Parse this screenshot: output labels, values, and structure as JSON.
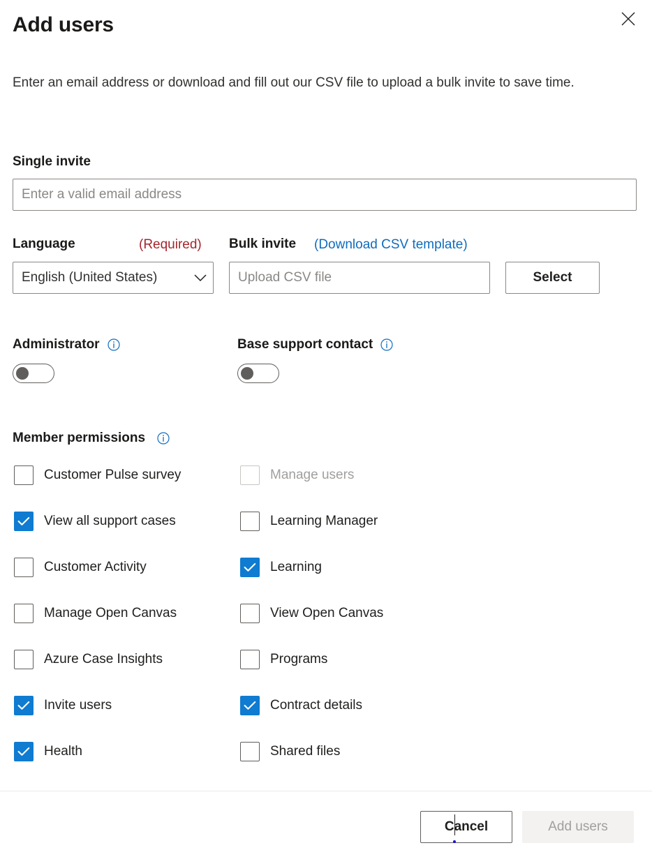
{
  "dialog": {
    "title": "Add users",
    "close_icon": "close-icon",
    "description": "Enter an email address or download and fill out our CSV file to upload a bulk invite to save time."
  },
  "single_invite": {
    "label": "Single invite",
    "email_placeholder": "Enter a valid email address",
    "email_value": ""
  },
  "language": {
    "label": "Language",
    "required_text": "(Required)",
    "selected": "English (United States)",
    "chevron_icon": "chevron-down-icon"
  },
  "bulk_invite": {
    "label": "Bulk invite",
    "download_link": "(Download CSV template)",
    "csv_placeholder": "Upload CSV file",
    "csv_value": "",
    "select_label": "Select"
  },
  "toggles": [
    {
      "label": "Administrator",
      "info_icon": "info-icon",
      "state": "off"
    },
    {
      "label": "Base support contact",
      "info_icon": "info-icon",
      "state": "off"
    }
  ],
  "member_permissions": {
    "title": "Member permissions",
    "info_icon": "info-icon",
    "rows": [
      {
        "left": {
          "label": "Customer Pulse survey",
          "checked": false,
          "disabled": false
        },
        "right": {
          "label": "Manage users",
          "checked": false,
          "disabled": true
        }
      },
      {
        "left": {
          "label": "View all support cases",
          "checked": true,
          "disabled": false
        },
        "right": {
          "label": "Learning Manager",
          "checked": false,
          "disabled": false
        }
      },
      {
        "left": {
          "label": "Customer Activity",
          "checked": false,
          "disabled": false
        },
        "right": {
          "label": "Learning",
          "checked": true,
          "disabled": false
        }
      },
      {
        "left": {
          "label": "Manage Open Canvas",
          "checked": false,
          "disabled": false
        },
        "right": {
          "label": "View Open Canvas",
          "checked": false,
          "disabled": false
        }
      },
      {
        "left": {
          "label": "Azure Case Insights",
          "checked": false,
          "disabled": false
        },
        "right": {
          "label": "Programs",
          "checked": false,
          "disabled": false
        }
      },
      {
        "left": {
          "label": "Invite users",
          "checked": true,
          "disabled": false
        },
        "right": {
          "label": "Contract details",
          "checked": true,
          "disabled": false
        }
      },
      {
        "left": {
          "label": "Health",
          "checked": true,
          "disabled": false
        },
        "right": {
          "label": "Shared files",
          "checked": false,
          "disabled": false
        }
      }
    ]
  },
  "footer": {
    "cancel_label": "Cancel",
    "submit_label": "Add users",
    "submit_disabled": true
  },
  "colors": {
    "accent_blue": "#0f7bd1",
    "link_blue": "#0f6cbd",
    "required_red": "#a4262c",
    "border_gray": "#8a8886",
    "disabled_text": "#a19f9d",
    "disabled_bg": "#f3f2f1"
  }
}
